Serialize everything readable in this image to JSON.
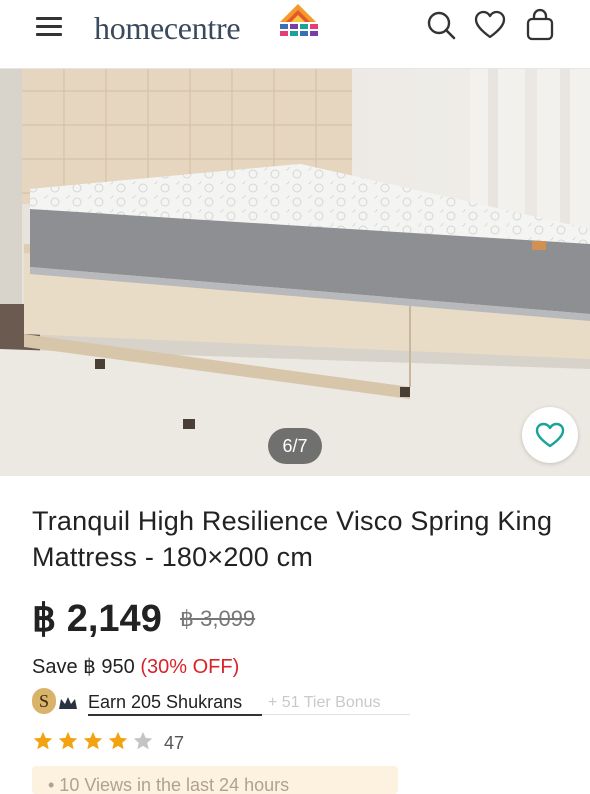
{
  "header": {
    "brand": "homecentre",
    "menu_icon": "hamburger-menu-icon",
    "search_icon": "search-icon",
    "wishlist_icon": "heart-icon",
    "bag_icon": "shopping-bag-icon"
  },
  "gallery": {
    "counter": "6/7",
    "current": 6,
    "total": 7,
    "wishlist_icon": "heart-outline-icon",
    "accent": "#1aa39a"
  },
  "product": {
    "title": "Tranquil High Resilience Visco Spring King Mattress - 180×200 cm",
    "price": "฿ 2,149",
    "old_price": "฿ 3,099",
    "save_label": "Save ฿ 950",
    "save_percent": "(30% OFF)",
    "save_color": "#d8232a"
  },
  "shukran": {
    "badge_letter": "S",
    "earn_text": "Earn 205 Shukrans",
    "tier_text": "+ 51   Tier Bonus"
  },
  "rating": {
    "stars": 4,
    "max": 5,
    "count": "47",
    "star_color": "#f2a311"
  },
  "views_banner": {
    "text": "• 10 Views in the last 24 hours"
  }
}
